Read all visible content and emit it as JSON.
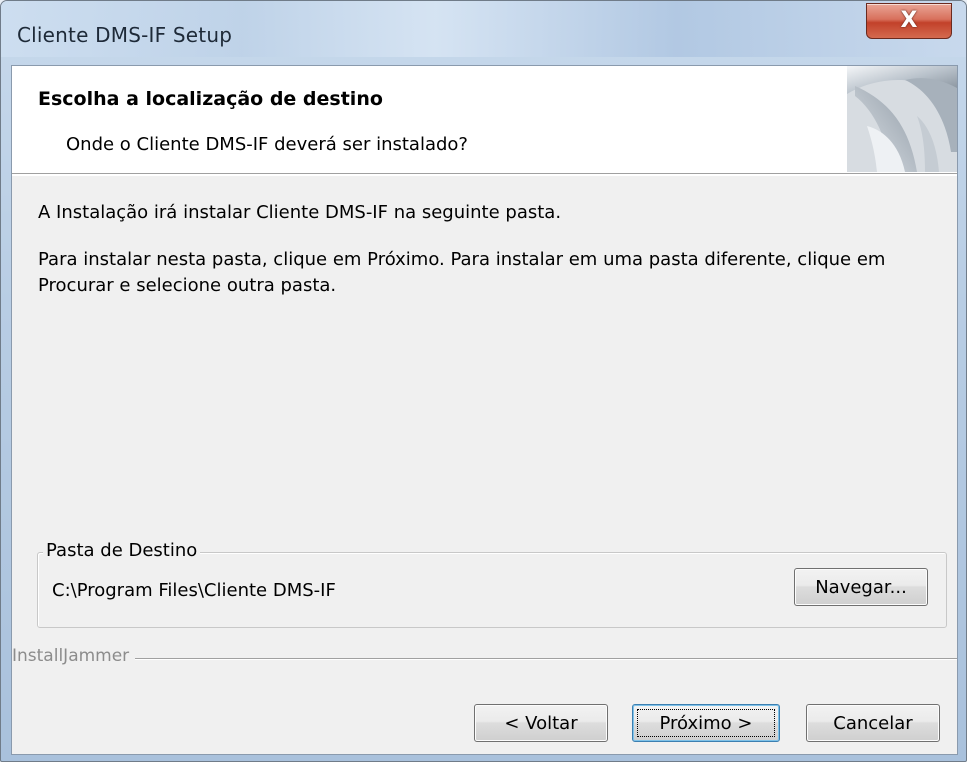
{
  "window": {
    "title": "Cliente DMS-IF Setup",
    "close_glyph": "X"
  },
  "header": {
    "title": "Escolha a localização de destino",
    "subtitle": "Onde o Cliente DMS-IF deverá ser instalado?",
    "graphic_icon": "installer-swirl-icon"
  },
  "body": {
    "line1": "A Instalação irá instalar Cliente DMS-IF na seguinte pasta.",
    "line2": "Para instalar nesta pasta, clique em Próximo.  Para instalar em uma pasta diferente, clique em Procurar e selecione outra pasta."
  },
  "destination": {
    "group_label": "Pasta de Destino",
    "path": "C:\\Program Files\\Cliente DMS-IF",
    "browse_label": "Navegar..."
  },
  "branding": {
    "label": "InstallJammer"
  },
  "buttons": {
    "back_label": "< Voltar",
    "next_label": "Próximo >",
    "cancel_label": "Cancelar"
  },
  "colors": {
    "close_button": "#c2412a",
    "dialog_background": "#f0f0f0",
    "header_background": "#ffffff",
    "default_button_border": "#3c7fb1"
  }
}
